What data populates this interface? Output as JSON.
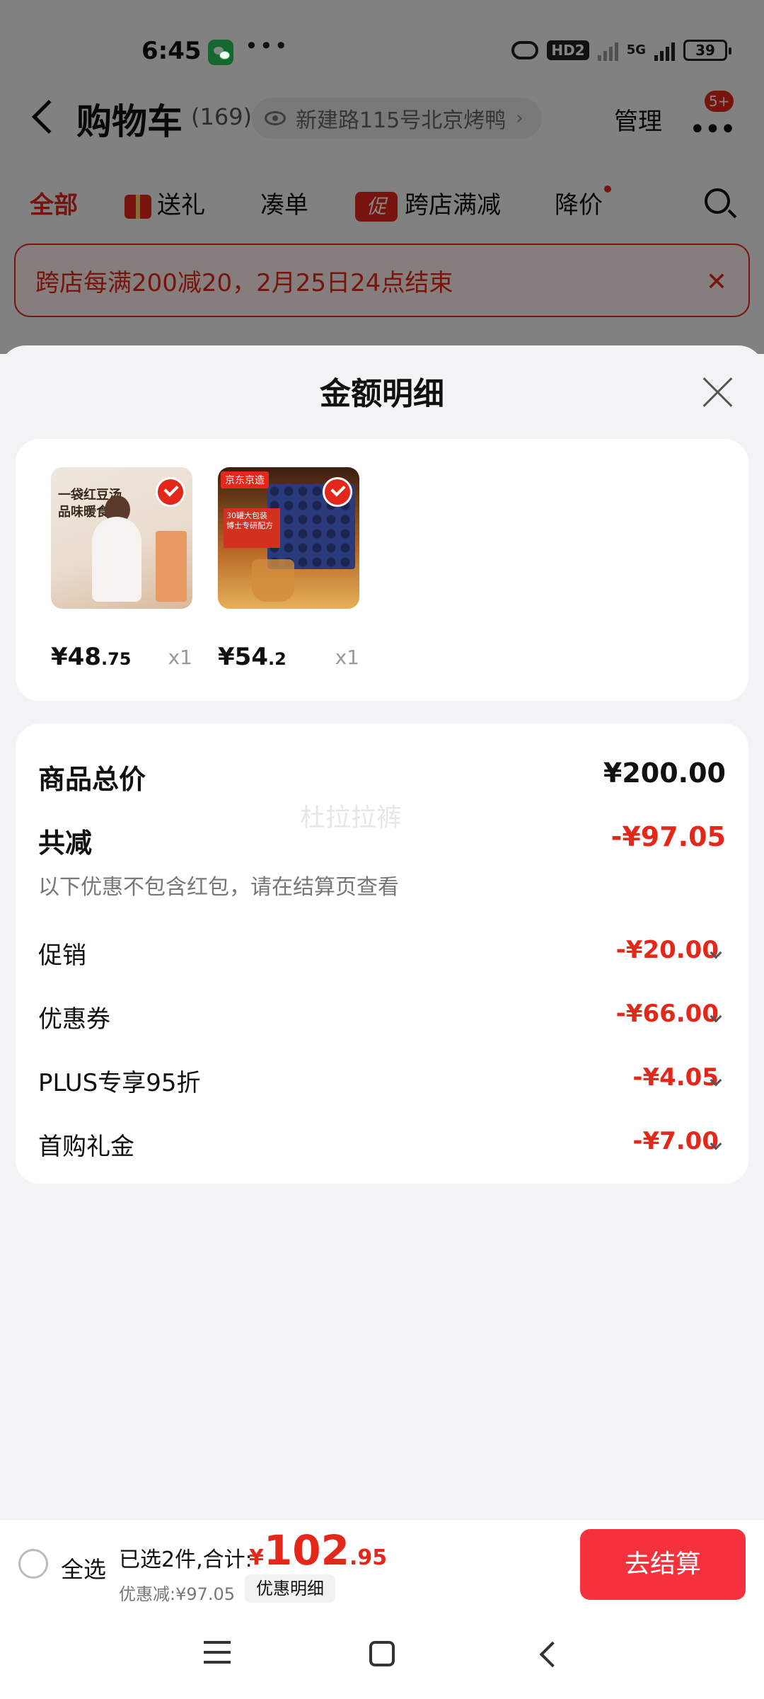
{
  "status_bar": {
    "time": "6:45",
    "dots": "•••",
    "hd_badge": "HD2",
    "network": "5G",
    "battery": "39"
  },
  "header": {
    "title": "购物车",
    "count": "(169)",
    "address": "新建路115号北京烤鸭",
    "address_chevron": "›",
    "manage": "管理",
    "more_icon": "•••",
    "badge": "5+"
  },
  "tabs": [
    {
      "label": "全部",
      "active": true
    },
    {
      "label": "送礼",
      "icon": "gift-icon"
    },
    {
      "label": "凑单"
    },
    {
      "label": "跨店满减",
      "tag": "促"
    },
    {
      "label": "降价",
      "dot": true
    }
  ],
  "promo_banner": {
    "text": "跨店每满200减20，2月25日24点结束",
    "close": "✕"
  },
  "sheet": {
    "title": "金额明细",
    "products": [
      {
        "caption": "一袋红豆汤 品味暖食光",
        "price_int": "¥48",
        "price_dec": ".75",
        "qty": "x1"
      },
      {
        "label": "京东京造",
        "caption": "30罐大包装 博士专研配方",
        "price_int": "¥54",
        "price_dec": ".2",
        "qty": "x1"
      }
    ],
    "breakdown": {
      "total_label": "商品总价",
      "total_value": "¥200.00",
      "reduce_label": "共减",
      "reduce_value": "-¥97.05",
      "note": "以下优惠不包含红包，请在结算页查看",
      "watermark": "杜拉拉裤",
      "items": [
        {
          "label": "促销",
          "value": "-¥20.00"
        },
        {
          "label": "优惠券",
          "value": "-¥66.00"
        },
        {
          "label": "PLUS专享95折",
          "value": "-¥4.05"
        },
        {
          "label": "首购礼金",
          "value": "-¥7.00"
        }
      ]
    }
  },
  "checkout": {
    "select_all": "全选",
    "summary": "已选2件,合计:",
    "currency": "¥",
    "total_int": "102",
    "total_dec": ".95",
    "discount": "优惠减:¥97.05",
    "detail_chip": "优惠明细",
    "button": "去结算"
  },
  "colors": {
    "accent": "#e4271b",
    "checkout_button": "#f5323c",
    "sheet_background": "#f3f3f5"
  }
}
